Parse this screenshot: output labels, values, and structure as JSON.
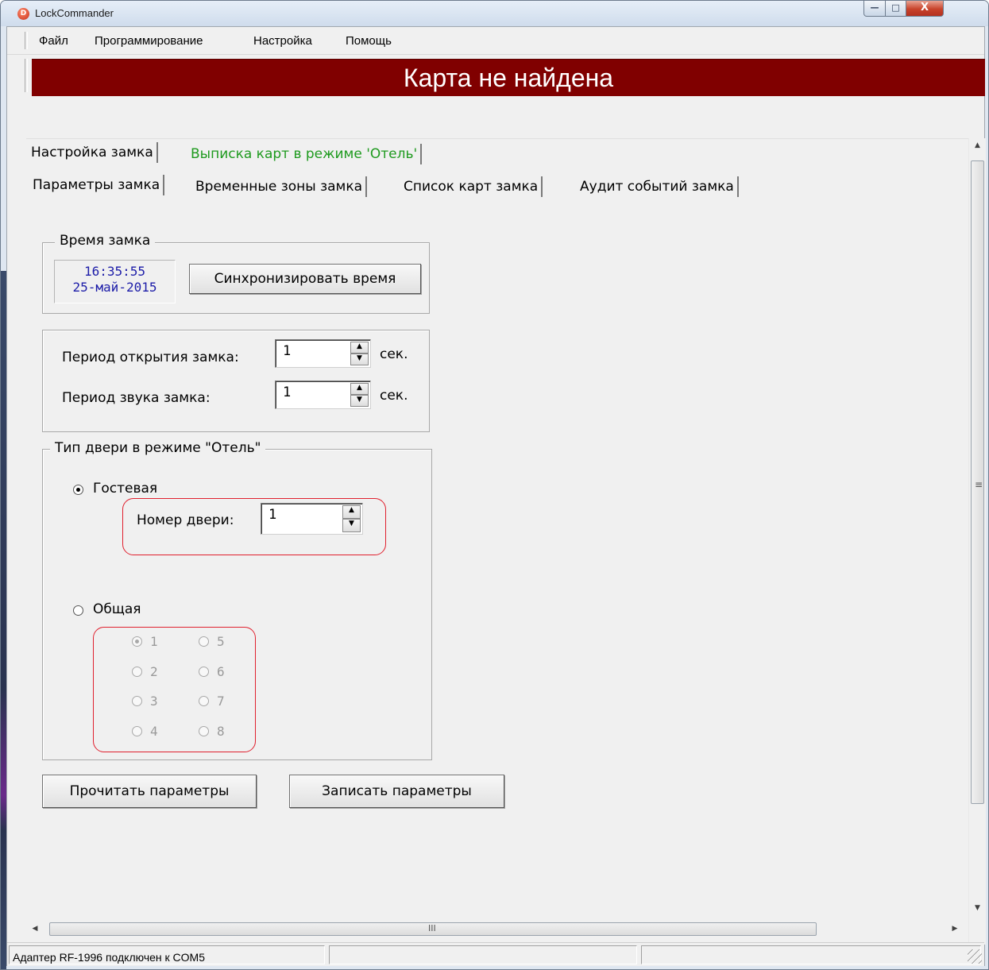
{
  "window": {
    "title": "LockCommander",
    "app_icon": "D"
  },
  "caption_buttons": {
    "minimize": "—",
    "maximize": "□",
    "close": "X"
  },
  "menu": {
    "items": [
      "Файл",
      "Программирование",
      "Настройка",
      "Помощь"
    ]
  },
  "banner": {
    "text": "Карта не найдена",
    "color": "#800000"
  },
  "tabs_top": [
    "Настройка замка",
    "Выписка карт в режиме 'Отель'"
  ],
  "tabs_sub": [
    "Параметры замка",
    "Временные зоны замка",
    "Список карт замка",
    "Аудит событий замка"
  ],
  "lock_time": {
    "legend": "Время замка",
    "time": "16:35:55",
    "date": "25-май-2015",
    "sync_button": "Синхронизировать время"
  },
  "periods": {
    "open_label": "Период открытия замка:",
    "open_value": "1",
    "sound_label": "Период звука замка:",
    "sound_value": "1",
    "unit": "сек."
  },
  "door_type": {
    "legend": "Тип двери в режиме \"Отель\"",
    "guest_label": "Гостевая",
    "guest_checked": true,
    "door_number_label": "Номер двери:",
    "door_number_value": "1",
    "common_label": "Общая",
    "common_checked": false,
    "common_options": [
      "1",
      "2",
      "3",
      "4",
      "5",
      "6",
      "7",
      "8"
    ],
    "common_selected": "1"
  },
  "buttons": {
    "read": "Прочитать параметры",
    "write": "Записать параметры"
  },
  "scrollbar_glyphs": {
    "up": "▲",
    "down": "▼",
    "left": "◀",
    "right": "▶",
    "v_grip": "≡",
    "h_grip": "III"
  },
  "status": {
    "text": "Адаптер RF-1996 подключен к COM5"
  }
}
